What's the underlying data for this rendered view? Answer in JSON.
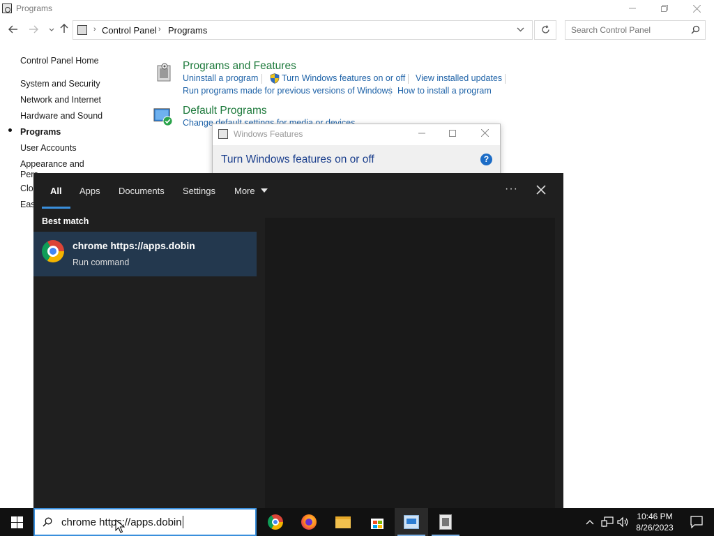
{
  "window": {
    "title": "Programs",
    "minimize_icon": "minimize-icon",
    "restore_icon": "restore-icon",
    "close_icon": "close-icon"
  },
  "address_bar": {
    "breadcrumbs": [
      "Control Panel",
      "Programs"
    ],
    "search_placeholder": "Search Control Panel"
  },
  "sidebar": {
    "items": [
      {
        "label": "Control Panel Home",
        "active": false
      },
      {
        "label": "System and Security",
        "active": false
      },
      {
        "label": "Network and Internet",
        "active": false
      },
      {
        "label": "Hardware and Sound",
        "active": false
      },
      {
        "label": "Programs",
        "active": true
      },
      {
        "label": "User Accounts",
        "active": false
      },
      {
        "label": "Appearance and",
        "active": false
      },
      {
        "label": "Pers",
        "active": false
      },
      {
        "label": "Clo",
        "active": false
      },
      {
        "label": "Eas",
        "active": false
      }
    ]
  },
  "sections": {
    "programs_features": {
      "title": "Programs and Features",
      "links": [
        "Uninstall a program",
        "Turn Windows features on or off",
        "View installed updates",
        "Run programs made for previous versions of Windows",
        "How to install a program"
      ]
    },
    "default_programs": {
      "title": "Default Programs",
      "links": [
        "Change default settings for media or devices"
      ]
    }
  },
  "windows_features": {
    "title": "Windows Features",
    "heading": "Turn Windows features on or off",
    "help": "?"
  },
  "search_panel": {
    "tabs": [
      "All",
      "Apps",
      "Documents",
      "Settings",
      "More"
    ],
    "active_tab": "All",
    "more_options": "···",
    "best_match_label": "Best match",
    "result": {
      "title": "chrome https://apps.dobin",
      "subtitle": "Run command",
      "icon": "chrome-icon"
    }
  },
  "taskbar": {
    "search_query": "chrome https://apps.dobin",
    "apps": [
      "chrome-icon",
      "firefox-icon",
      "file-explorer-icon",
      "microsoft-store-icon",
      "control-panel-icon",
      "windows-features-icon"
    ],
    "active_app": "control-panel-icon",
    "clock": {
      "time": "10:46 PM",
      "date": "8/26/2023"
    }
  },
  "colors": {
    "accent": "#3a8fdc",
    "section_title": "#1e7a3c",
    "link": "#1f63a8",
    "panel_bg": "#1f1f1f",
    "result_highlight": "#23384e"
  }
}
